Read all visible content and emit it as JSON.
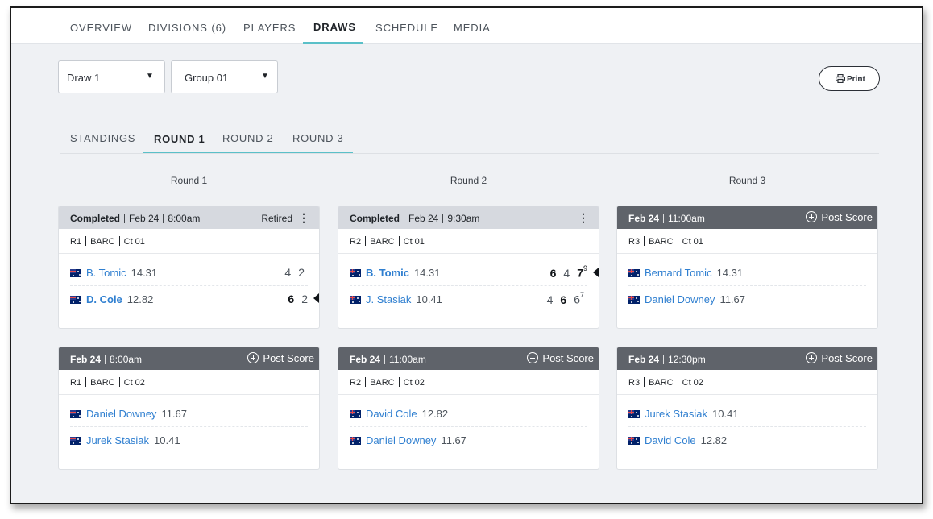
{
  "nav": {
    "tabs": [
      "OVERVIEW",
      "DIVISIONS (6)",
      "PLAYERS",
      "DRAWS",
      "SCHEDULE",
      "MEDIA"
    ],
    "active": "DRAWS"
  },
  "filters": {
    "draw_value": "Draw 1",
    "group_value": "Group 01"
  },
  "print_label": "Print",
  "subtabs": {
    "items": [
      "STANDINGS",
      "ROUND 1",
      "ROUND 2",
      "ROUND 3"
    ],
    "active": "ROUND 1"
  },
  "rounds": [
    "Round 1",
    "Round 2",
    "Round 3"
  ],
  "colors": {
    "accent": "#5ac0c8",
    "link": "#2f7fd0",
    "completed_header": "#d6d9df",
    "scheduled_header": "#5f636a"
  },
  "post_score_label": "Post Score",
  "matches": [
    {
      "status": "Completed",
      "date": "Feb 24",
      "time": "8:00am",
      "note": "Retired",
      "round": "R1",
      "venue": "BARC",
      "court": "Ct 01",
      "p1": {
        "name": "B. Tomic",
        "rating": "14.31",
        "scores": [
          "4",
          "2"
        ]
      },
      "p2": {
        "name": "D. Cole",
        "rating": "12.82",
        "scores": [
          "6",
          "2"
        ]
      }
    },
    {
      "status": "Completed",
      "date": "Feb 24",
      "time": "9:30am",
      "round": "R2",
      "venue": "BARC",
      "court": "Ct 01",
      "p1": {
        "name": "B. Tomic",
        "rating": "14.31",
        "scores": [
          "6",
          "4",
          "7"
        ],
        "tiebreak": "9"
      },
      "p2": {
        "name": "J. Stasiak",
        "rating": "10.41",
        "scores": [
          "4",
          "6",
          "6"
        ],
        "tiebreak": "7"
      }
    },
    {
      "date": "Feb 24",
      "time": "11:00am",
      "round": "R3",
      "venue": "BARC",
      "court": "Ct 01",
      "p1": {
        "name": "Bernard Tomic",
        "rating": "14.31"
      },
      "p2": {
        "name": "Daniel Downey",
        "rating": "11.67"
      }
    },
    {
      "date": "Feb 24",
      "time": "8:00am",
      "round": "R1",
      "venue": "BARC",
      "court": "Ct 02",
      "p1": {
        "name": "Daniel Downey",
        "rating": "11.67"
      },
      "p2": {
        "name": "Jurek Stasiak",
        "rating": "10.41"
      }
    },
    {
      "date": "Feb 24",
      "time": "11:00am",
      "round": "R2",
      "venue": "BARC",
      "court": "Ct 02",
      "p1": {
        "name": "David Cole",
        "rating": "12.82"
      },
      "p2": {
        "name": "Daniel Downey",
        "rating": "11.67"
      }
    },
    {
      "date": "Feb 24",
      "time": "12:30pm",
      "round": "R3",
      "venue": "BARC",
      "court": "Ct 02",
      "p1": {
        "name": "Jurek Stasiak",
        "rating": "10.41"
      },
      "p2": {
        "name": "David Cole",
        "rating": "12.82"
      }
    }
  ]
}
